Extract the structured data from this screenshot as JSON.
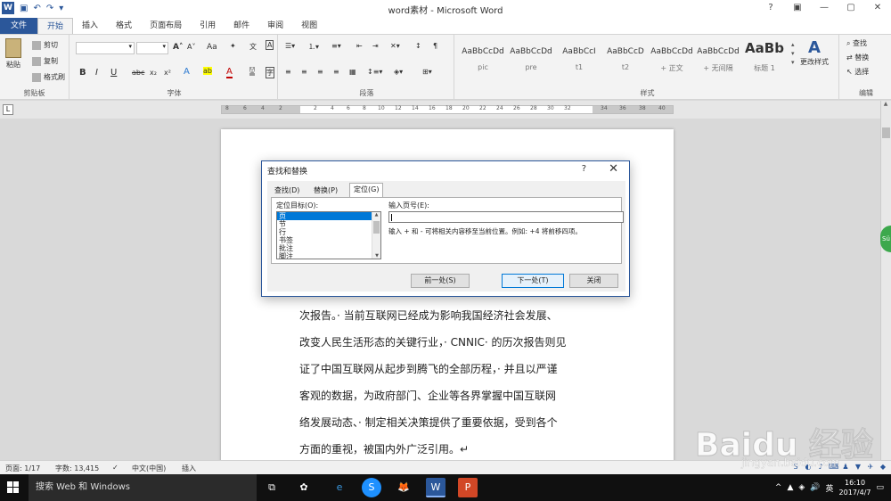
{
  "app": {
    "title": "word素材 - Microsoft Word",
    "logo_letter": "W",
    "help_glyph": "?",
    "window_controls": [
      "—",
      "▢",
      "✕"
    ],
    "ribbon_display_glyph": "▣",
    "qat_icons": [
      "save-icon",
      "undo-icon",
      "redo-icon",
      "customize-icon"
    ]
  },
  "tabs": [
    "文件",
    "开始",
    "插入",
    "格式",
    "页面布局",
    "引用",
    "邮件",
    "审阅",
    "视图"
  ],
  "ribbon": {
    "clipboard": {
      "paste": "粘贴",
      "cut": "剪切",
      "copy": "复制",
      "format_painter": "格式刷",
      "label": "剪贴板"
    },
    "font": {
      "font_name": "",
      "font_size": "",
      "grow_glyph": "A˄",
      "shrink_glyph": "A˅",
      "case_glyph": "Aa",
      "bold": "B",
      "italic": "I",
      "underline": "U",
      "strike": "abc",
      "subscript": "x₂",
      "superscript": "x²",
      "label": "字体"
    },
    "paragraph": {
      "label": "段落"
    },
    "styles": {
      "items": [
        {
          "sample": "AaBbCcDd",
          "name": "pic"
        },
        {
          "sample": "AaBbCcDd",
          "name": "pre"
        },
        {
          "sample": "AaBbCcI",
          "name": "t1"
        },
        {
          "sample": "AaBbCcD",
          "name": "t2"
        },
        {
          "sample": "AaBbCcDd",
          "name": "+ 正文"
        },
        {
          "sample": "AaBbCcDd",
          "name": "+ 无间隔"
        },
        {
          "sample": "AaBb",
          "name": "标题 1"
        }
      ],
      "change_styles": "更改样式",
      "label": "样式"
    },
    "editing": {
      "find": "查找",
      "replace": "替换",
      "select": "选择",
      "label": "编辑"
    }
  },
  "ruler": {
    "corner_glyph": "L",
    "ticks": [
      "8",
      "6",
      "4",
      "2",
      "2",
      "4",
      "6",
      "8",
      "10",
      "12",
      "14",
      "16",
      "18",
      "20",
      "22",
      "24",
      "26",
      "28",
      "30",
      "32",
      "34",
      "36",
      "38",
      "40"
    ]
  },
  "document": {
    "lines": [
      "次报告。· 当前互联网已经成为影响我国经济社会发展、",
      "改变人民生活形态的关键行业，· CNNIC· 的历次报告则见",
      "证了中国互联网从起步到腾飞的全部历程，· 并且以严谨",
      "客观的数据，为政府部门、企业等各界掌握中国互联网",
      "络发展动态、· 制定相关决策提供了重要依据，受到各个",
      "方面的重视，被国内外广泛引用。↵"
    ]
  },
  "dialog": {
    "title": "查找和替换",
    "help": "?",
    "close": "✕",
    "tabs": [
      "查找(D)",
      "替换(P)",
      "定位(G)"
    ],
    "active_tab": 2,
    "target_label": "定位目标(O):",
    "targets": [
      "页",
      "节",
      "行",
      "书签",
      "批注",
      "脚注"
    ],
    "selected_target": 0,
    "page_label": "输入页号(E):",
    "page_value": "",
    "hint": "输入 + 和 - 可将相关内容移至当前位置。例如: +4 将前移四项。",
    "buttons": {
      "previous": "前一处(S)",
      "next": "下一处(T)",
      "close": "关闭"
    }
  },
  "status": {
    "page": "页面: 1/17",
    "words": "字数: 13,415",
    "language": "中文(中国)",
    "mode": "插入"
  },
  "side_badge": "Sü",
  "taskbar": {
    "search_placeholder": "搜索 Web 和 Windows",
    "apps": [
      "⧉",
      "✿",
      "e",
      "S",
      "🦊",
      "W",
      "P"
    ],
    "tray": [
      "^",
      "▲",
      "◈",
      "🔊",
      "英"
    ],
    "time": "16:10",
    "date": "2017/4/7"
  },
  "watermark": {
    "text": "Baidu 经验",
    "sub": "jingyan.baidu.com"
  },
  "colors": {
    "word_blue": "#2b579a",
    "selection": "#0078d7"
  }
}
